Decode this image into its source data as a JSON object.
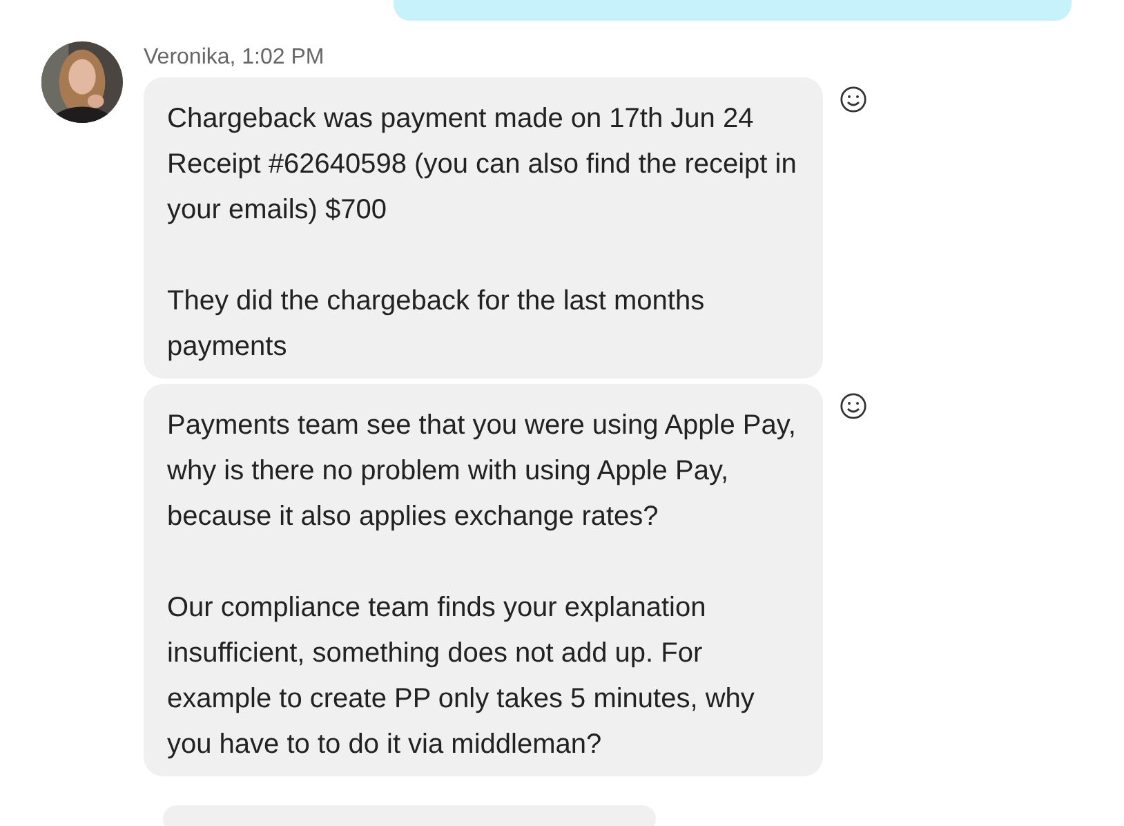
{
  "messages": [
    {
      "sender": "Veronika, 1:02 PM",
      "paragraphs": [
        "Chargeback was payment made on 17th Jun 24 Receipt #62640598 (you can also find the receipt in your emails) $700",
        "They did the chargeback for the last months payments"
      ]
    },
    {
      "paragraphs": [
        "Payments team see that you were using Apple Pay, why is there no problem with using Apple Pay, because it also applies exchange rates?",
        "Our compliance team finds your explanation insufficient, something does not add up. For example to create PP only takes 5 minutes, why you have to to do it via middleman?"
      ]
    }
  ]
}
